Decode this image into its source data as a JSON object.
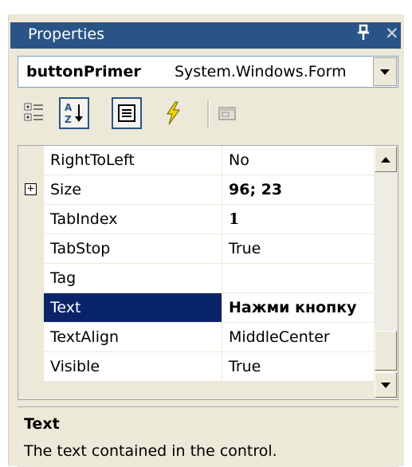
{
  "window": {
    "title": "Properties",
    "pin_glyph": "†",
    "close_glyph": "✕"
  },
  "object_selector": {
    "object_name": "buttonPrimer",
    "object_type": "System.Windows.Form"
  },
  "toolbar": {
    "buttons": [
      {
        "name": "categorized",
        "icon": "categorized-icon",
        "pressed": false
      },
      {
        "name": "alphabetical",
        "icon": "alphabetical-sort-icon",
        "pressed": true
      },
      {
        "name": "properties",
        "icon": "properties-icon",
        "pressed": true
      },
      {
        "name": "events",
        "icon": "lightning-icon",
        "pressed": false
      },
      {
        "name": "property-pages",
        "icon": "property-pages-icon",
        "pressed": false
      }
    ]
  },
  "grid": {
    "rows": [
      {
        "name": "RightToLeft",
        "value": "No",
        "bold": false,
        "expandable": false,
        "selected": false
      },
      {
        "name": "Size",
        "value": "96; 23",
        "bold": true,
        "expandable": true,
        "selected": false
      },
      {
        "name": "TabIndex",
        "value": "1",
        "bold": true,
        "expandable": false,
        "selected": false
      },
      {
        "name": "TabStop",
        "value": "True",
        "bold": false,
        "expandable": false,
        "selected": false
      },
      {
        "name": "Tag",
        "value": "",
        "bold": false,
        "expandable": false,
        "selected": false
      },
      {
        "name": "Text",
        "value": "Нажми кнопку",
        "bold": true,
        "expandable": false,
        "selected": true
      },
      {
        "name": "TextAlign",
        "value": "MiddleCenter",
        "bold": false,
        "expandable": false,
        "selected": false
      },
      {
        "name": "Visible",
        "value": "True",
        "bold": false,
        "expandable": false,
        "selected": false
      }
    ],
    "expander_glyph": "+"
  },
  "description": {
    "title": "Text",
    "text": "The text contained in the control."
  },
  "colors": {
    "titlebar": "#2b5486",
    "selection": "#0a246a",
    "panel": "#ece9d8"
  }
}
